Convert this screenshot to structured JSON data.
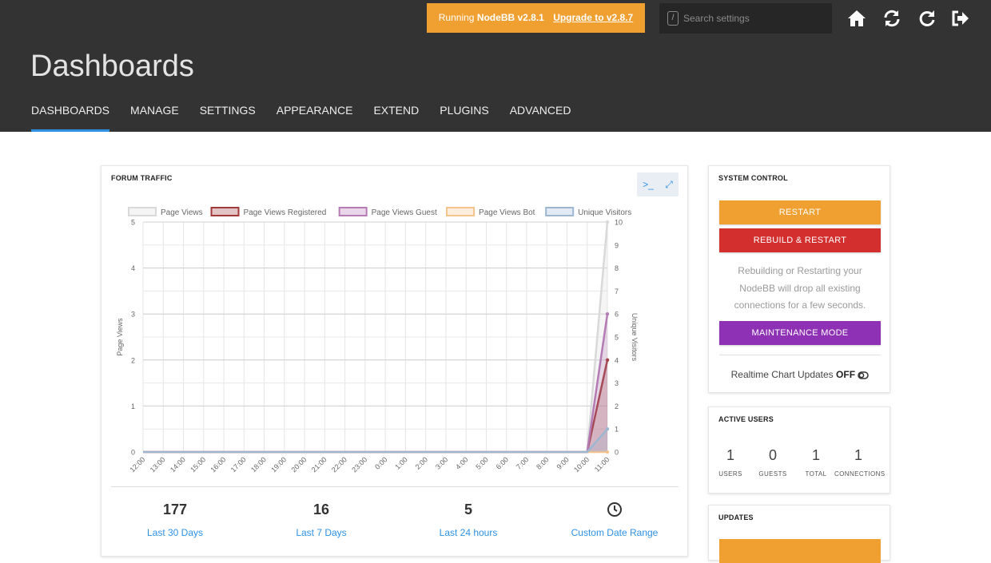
{
  "header": {
    "banner_prefix": "Running",
    "banner_version": "NodeBB v2.8.1",
    "banner_upgrade": "Upgrade to v2.8.7",
    "search_shortcut": "/",
    "search_placeholder": "Search settings",
    "icons": [
      "home-icon",
      "refresh-icon",
      "reload-icon",
      "logout-icon"
    ],
    "page_title": "Dashboards",
    "tabs": [
      "DASHBOARDS",
      "MANAGE",
      "SETTINGS",
      "APPEARANCE",
      "EXTEND",
      "PLUGINS",
      "ADVANCED"
    ],
    "active_tab": "DASHBOARDS"
  },
  "traffic": {
    "title": "FORUM TRAFFIC",
    "toolbar_icons": [
      "terminal-icon",
      "expand-icon"
    ],
    "stats": [
      {
        "value": "177",
        "label": "Last 30 Days"
      },
      {
        "value": "16",
        "label": "Last 7 Days"
      },
      {
        "value": "5",
        "label": "Last 24 hours"
      },
      {
        "value": "",
        "label": "Custom Date Range"
      }
    ]
  },
  "chart_data": {
    "type": "line",
    "x": [
      "12:00",
      "13:00",
      "14:00",
      "15:00",
      "16:00",
      "17:00",
      "18:00",
      "19:00",
      "20:00",
      "21:00",
      "22:00",
      "23:00",
      "0:00",
      "1:00",
      "2:00",
      "3:00",
      "4:00",
      "5:00",
      "6:00",
      "7:00",
      "8:00",
      "9:00",
      "10:00",
      "11:00"
    ],
    "ylabel": "Page Views",
    "ylabel_right": "Unique Visitors",
    "ylim": [
      0,
      5
    ],
    "ylim_right": [
      0,
      10
    ],
    "yticks": [
      "0",
      "1",
      "2",
      "3",
      "4",
      "5"
    ],
    "yticks_right": [
      "0",
      "1",
      "2",
      "3",
      "4",
      "5",
      "6",
      "7",
      "8",
      "9",
      "10"
    ],
    "legend_position": "top",
    "grid": true,
    "series": [
      {
        "name": "Page Views",
        "axis": "left",
        "color": "#d9d9d9",
        "values": [
          0,
          0,
          0,
          0,
          0,
          0,
          0,
          0,
          0,
          0,
          0,
          0,
          0,
          0,
          0,
          0,
          0,
          0,
          0,
          0,
          0,
          0,
          0,
          5
        ]
      },
      {
        "name": "Page Views Registered",
        "axis": "left",
        "color": "#a33a3a",
        "values": [
          0,
          0,
          0,
          0,
          0,
          0,
          0,
          0,
          0,
          0,
          0,
          0,
          0,
          0,
          0,
          0,
          0,
          0,
          0,
          0,
          0,
          0,
          0,
          2
        ]
      },
      {
        "name": "Page Views Guest",
        "axis": "left",
        "color": "#b57bb5",
        "values": [
          0,
          0,
          0,
          0,
          0,
          0,
          0,
          0,
          0,
          0,
          0,
          0,
          0,
          0,
          0,
          0,
          0,
          0,
          0,
          0,
          0,
          0,
          0,
          3
        ]
      },
      {
        "name": "Page Views Bot",
        "axis": "left",
        "color": "#f6c48a",
        "values": [
          0,
          0,
          0,
          0,
          0,
          0,
          0,
          0,
          0,
          0,
          0,
          0,
          0,
          0,
          0,
          0,
          0,
          0,
          0,
          0,
          0,
          0,
          0,
          0
        ]
      },
      {
        "name": "Unique Visitors",
        "axis": "right",
        "color": "#9db7d3",
        "values": [
          0,
          0,
          0,
          0,
          0,
          0,
          0,
          0,
          0,
          0,
          0,
          0,
          0,
          0,
          0,
          0,
          0,
          0,
          0,
          0,
          0,
          0,
          0,
          1
        ]
      }
    ]
  },
  "system": {
    "title": "SYSTEM CONTROL",
    "restart": "RESTART",
    "rebuild": "REBUILD & RESTART",
    "note": "Rebuilding or Restarting your NodeBB will drop all existing connections for a few seconds.",
    "maintenance": "MAINTENANCE MODE",
    "realtime_label": "Realtime Chart Updates",
    "realtime_state": "OFF"
  },
  "active_users": {
    "title": "ACTIVE USERS",
    "stats": [
      {
        "value": "1",
        "label": "USERS"
      },
      {
        "value": "0",
        "label": "GUESTS"
      },
      {
        "value": "1",
        "label": "TOTAL"
      },
      {
        "value": "1",
        "label": "CONNECTIONS"
      }
    ]
  },
  "updates": {
    "title": "UPDATES"
  },
  "colors": {
    "topbar": "#333333",
    "accent": "#2e91e6",
    "warning": "#f0a030",
    "danger": "#d32f2f",
    "maintenance": "#8e31b5"
  }
}
